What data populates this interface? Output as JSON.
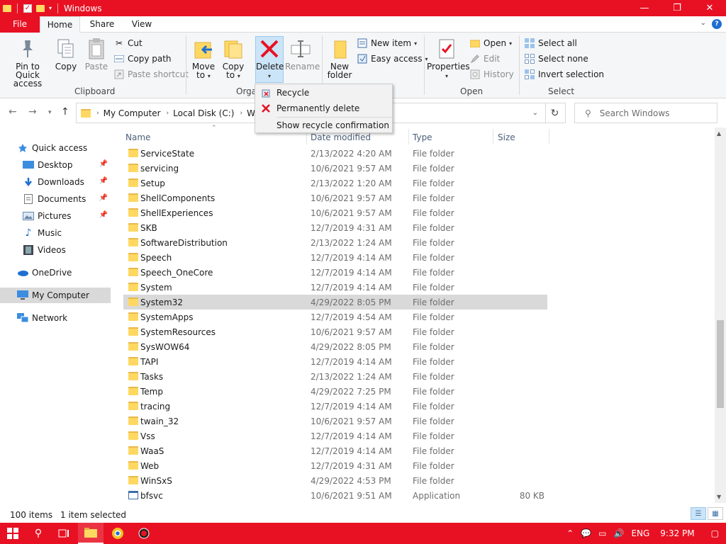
{
  "window": {
    "title": "Windows",
    "controls": {
      "minimize": "—",
      "maximize": "❐",
      "close": "✕"
    }
  },
  "ribbon_tabs": {
    "file": "File",
    "home": "Home",
    "share": "Share",
    "view": "View"
  },
  "ribbon": {
    "clipboard": {
      "pin_label": "Pin to Quick access",
      "copy_label": "Copy",
      "paste_label": "Paste",
      "cut_label": "Cut",
      "copy_path_label": "Copy path",
      "paste_shortcut_label": "Paste shortcut",
      "group_label": "Clipboard"
    },
    "organize": {
      "move_to_label": "Move to",
      "copy_to_label": "Copy to",
      "delete_label": "Delete",
      "rename_label": "Rename",
      "group_label": "Orga"
    },
    "new": {
      "new_folder_label": "New folder",
      "new_item_label": "New item",
      "easy_access_label": "Easy access"
    },
    "open": {
      "properties_label": "Properties",
      "open_label": "Open",
      "edit_label": "Edit",
      "history_label": "History",
      "group_label": "Open"
    },
    "select": {
      "select_all_label": "Select all",
      "select_none_label": "Select none",
      "invert_label": "Invert selection",
      "group_label": "Select"
    }
  },
  "delete_menu": {
    "recycle": "Recycle",
    "permanently_delete": "Permanently delete",
    "show_confirmation": "Show recycle confirmation"
  },
  "address": {
    "crumbs": [
      "My Computer",
      "Local Disk (C:)",
      "Win"
    ],
    "search_placeholder": "Search Windows"
  },
  "navpane": {
    "items": [
      {
        "label": "Quick access",
        "icon": "star-icon"
      },
      {
        "label": "Desktop",
        "icon": "desktop-icon"
      },
      {
        "label": "Downloads",
        "icon": "download-icon"
      },
      {
        "label": "Documents",
        "icon": "document-icon"
      },
      {
        "label": "Pictures",
        "icon": "picture-icon"
      },
      {
        "label": "Music",
        "icon": "music-icon"
      },
      {
        "label": "Videos",
        "icon": "video-icon"
      },
      {
        "label": "OneDrive",
        "icon": "cloud-icon"
      },
      {
        "label": "My Computer",
        "icon": "computer-icon"
      },
      {
        "label": "Network",
        "icon": "network-icon"
      }
    ]
  },
  "columns": {
    "name": "Name",
    "date": "Date modified",
    "type": "Type",
    "size": "Size"
  },
  "files": [
    {
      "name": "ServiceState",
      "date": "2/13/2022 4:20 AM",
      "type": "File folder",
      "size": ""
    },
    {
      "name": "servicing",
      "date": "10/6/2021 9:57 AM",
      "type": "File folder",
      "size": ""
    },
    {
      "name": "Setup",
      "date": "2/13/2022 1:20 AM",
      "type": "File folder",
      "size": ""
    },
    {
      "name": "ShellComponents",
      "date": "10/6/2021 9:57 AM",
      "type": "File folder",
      "size": ""
    },
    {
      "name": "ShellExperiences",
      "date": "10/6/2021 9:57 AM",
      "type": "File folder",
      "size": ""
    },
    {
      "name": "SKB",
      "date": "12/7/2019 4:31 AM",
      "type": "File folder",
      "size": ""
    },
    {
      "name": "SoftwareDistribution",
      "date": "2/13/2022 1:24 AM",
      "type": "File folder",
      "size": ""
    },
    {
      "name": "Speech",
      "date": "12/7/2019 4:14 AM",
      "type": "File folder",
      "size": ""
    },
    {
      "name": "Speech_OneCore",
      "date": "12/7/2019 4:14 AM",
      "type": "File folder",
      "size": ""
    },
    {
      "name": "System",
      "date": "12/7/2019 4:14 AM",
      "type": "File folder",
      "size": ""
    },
    {
      "name": "System32",
      "date": "4/29/2022 8:05 PM",
      "type": "File folder",
      "size": ""
    },
    {
      "name": "SystemApps",
      "date": "12/7/2019 4:54 AM",
      "type": "File folder",
      "size": ""
    },
    {
      "name": "SystemResources",
      "date": "10/6/2021 9:57 AM",
      "type": "File folder",
      "size": ""
    },
    {
      "name": "SysWOW64",
      "date": "4/29/2022 8:05 PM",
      "type": "File folder",
      "size": ""
    },
    {
      "name": "TAPI",
      "date": "12/7/2019 4:14 AM",
      "type": "File folder",
      "size": ""
    },
    {
      "name": "Tasks",
      "date": "2/13/2022 1:24 AM",
      "type": "File folder",
      "size": ""
    },
    {
      "name": "Temp",
      "date": "4/29/2022 7:25 PM",
      "type": "File folder",
      "size": ""
    },
    {
      "name": "tracing",
      "date": "12/7/2019 4:14 AM",
      "type": "File folder",
      "size": ""
    },
    {
      "name": "twain_32",
      "date": "10/6/2021 9:57 AM",
      "type": "File folder",
      "size": ""
    },
    {
      "name": "Vss",
      "date": "12/7/2019 4:14 AM",
      "type": "File folder",
      "size": ""
    },
    {
      "name": "WaaS",
      "date": "12/7/2019 4:14 AM",
      "type": "File folder",
      "size": ""
    },
    {
      "name": "Web",
      "date": "12/7/2019 4:31 AM",
      "type": "File folder",
      "size": ""
    },
    {
      "name": "WinSxS",
      "date": "4/29/2022 4:53 PM",
      "type": "File folder",
      "size": ""
    },
    {
      "name": "bfsvc",
      "date": "10/6/2021 9:51 AM",
      "type": "Application",
      "size": "80 KB"
    }
  ],
  "selected_file": "System32",
  "status": {
    "count": "100 items",
    "selected": "1 item selected"
  },
  "taskbar": {
    "language": "ENG",
    "time": "9:32 PM"
  },
  "colors": {
    "accent": "#e81123",
    "selection": "#d9d9d9",
    "folder": "#ffd862"
  }
}
